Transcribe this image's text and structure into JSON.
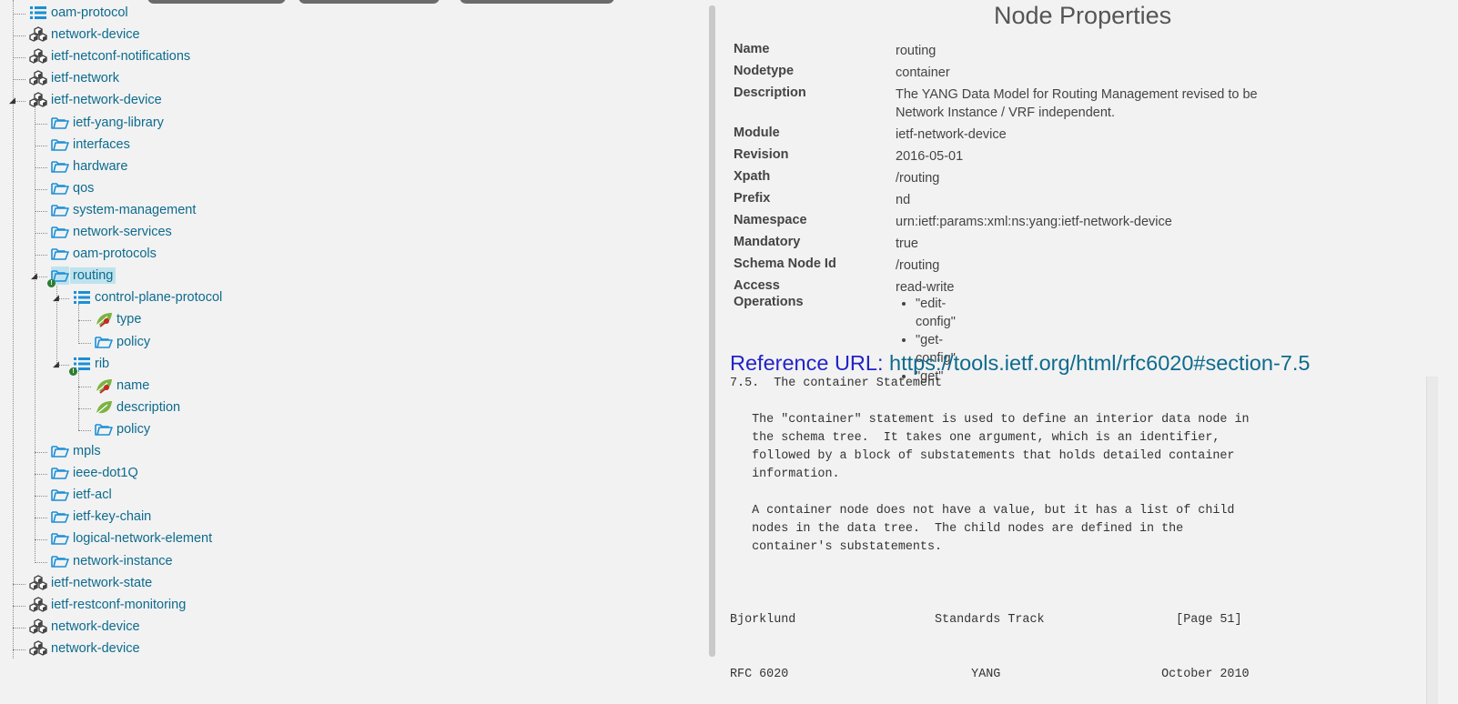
{
  "tree": {
    "nodes": [
      {
        "label": "oam-protocol",
        "icon": "list-icon"
      },
      {
        "label": "network-device",
        "icon": "module-icon"
      },
      {
        "label": "ietf-netconf-notifications",
        "icon": "module-icon"
      },
      {
        "label": "ietf-network",
        "icon": "module-icon"
      },
      {
        "label": "ietf-network-device",
        "icon": "module-icon"
      },
      {
        "label": "ietf-yang-library",
        "icon": "folder-icon"
      },
      {
        "label": "interfaces",
        "icon": "folder-icon"
      },
      {
        "label": "hardware",
        "icon": "folder-icon"
      },
      {
        "label": "qos",
        "icon": "folder-icon"
      },
      {
        "label": "system-management",
        "icon": "folder-icon"
      },
      {
        "label": "network-services",
        "icon": "folder-icon"
      },
      {
        "label": "oam-protocols",
        "icon": "folder-icon"
      },
      {
        "label": "routing",
        "icon": "folder-icon"
      },
      {
        "label": "control-plane-protocol",
        "icon": "list-icon"
      },
      {
        "label": "type",
        "icon": "leaf-key-icon"
      },
      {
        "label": "policy",
        "icon": "folder-icon"
      },
      {
        "label": "rib",
        "icon": "list-icon"
      },
      {
        "label": "name",
        "icon": "leaf-key-icon"
      },
      {
        "label": "description",
        "icon": "leaf-icon"
      },
      {
        "label": "policy",
        "icon": "folder-icon"
      },
      {
        "label": "mpls",
        "icon": "folder-icon"
      },
      {
        "label": "ieee-dot1Q",
        "icon": "folder-icon"
      },
      {
        "label": "ietf-acl",
        "icon": "folder-icon"
      },
      {
        "label": "ietf-key-chain",
        "icon": "folder-icon"
      },
      {
        "label": "logical-network-element",
        "icon": "folder-icon"
      },
      {
        "label": "network-instance",
        "icon": "folder-icon"
      },
      {
        "label": "ietf-network-state",
        "icon": "module-icon"
      },
      {
        "label": "ietf-restconf-monitoring",
        "icon": "module-icon"
      },
      {
        "label": "network-device",
        "icon": "module-icon"
      },
      {
        "label": "network-device",
        "icon": "module-icon"
      }
    ],
    "selected": "routing"
  },
  "props": {
    "title": "Node Properties",
    "rows": [
      {
        "key": "Name",
        "value": "routing"
      },
      {
        "key": "Nodetype",
        "value": "container"
      },
      {
        "key": "Description",
        "value": "The YANG Data Model for Routing Management revised to be Network Instance / VRF independent."
      },
      {
        "key": "Module",
        "value": "ietf-network-device"
      },
      {
        "key": "Revision",
        "value": "2016-05-01"
      },
      {
        "key": "Xpath",
        "value": "/routing"
      },
      {
        "key": "Prefix",
        "value": "nd"
      },
      {
        "key": "Namespace",
        "value": "urn:ietf:params:xml:ns:yang:ietf-network-device"
      },
      {
        "key": "Mandatory",
        "value": "true"
      },
      {
        "key": "Schema Node Id",
        "value": "/routing"
      },
      {
        "key": "Access",
        "value": "read-write"
      }
    ],
    "operations_label": "Operations",
    "operations": [
      "\"edit-config\"",
      "\"get-config\"",
      "\"get\""
    ],
    "reference_label": "Reference URL: ",
    "reference_url": "https://tools.ietf.org/html/rfc6020#section-7.5",
    "rfc_text": "7.5.  The container Statement\n\n   The \"container\" statement is used to define an interior data node in\n   the schema tree.  It takes one argument, which is an identifier,\n   followed by a block of substatements that holds detailed container\n   information.\n\n   A container node does not have a value, but it has a list of child\n   nodes in the data tree.  The child nodes are defined in the\n   container's substatements.\n\n\n\nBjorklund                   Standards Track                  [Page 51]\n\n\nRFC 6020                         YANG                      October 2010"
  },
  "colors": {
    "link": "#0d6b8e",
    "icon_blue": "#1b8fd6",
    "selected_bg": "#bfe3ee",
    "leaf_green": "#7cb342",
    "key_red": "#c62828",
    "reference_label": "#2323c8"
  }
}
